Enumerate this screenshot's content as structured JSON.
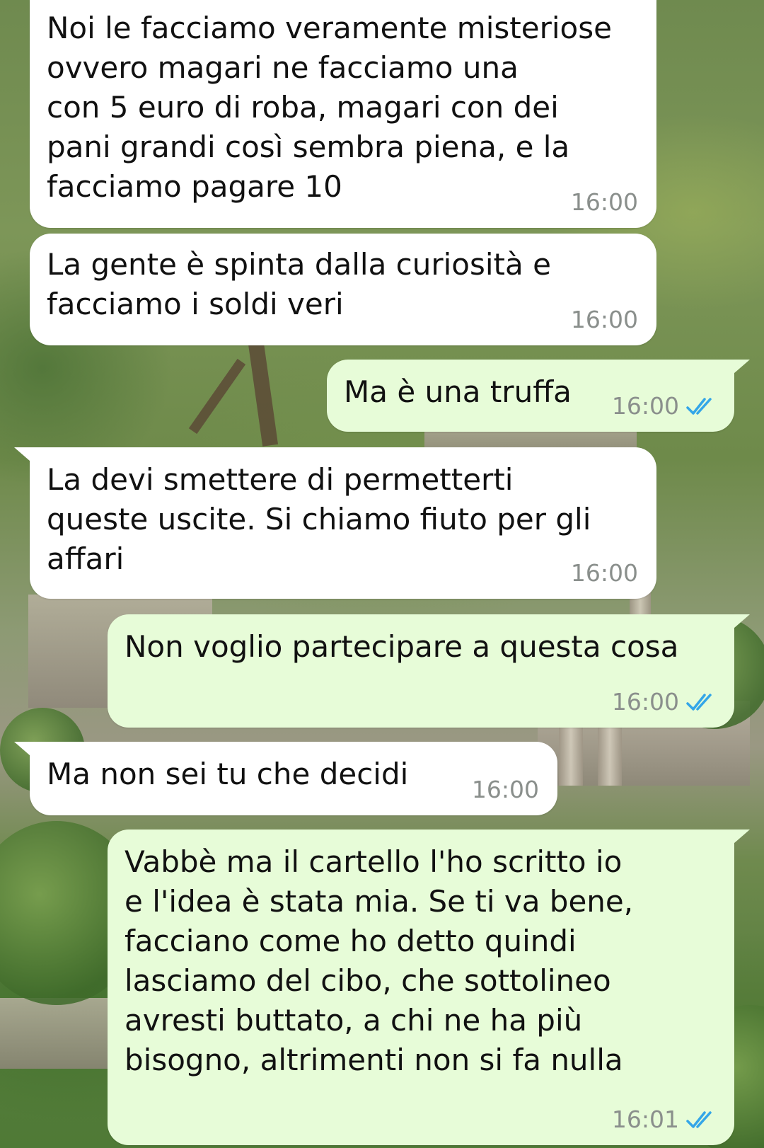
{
  "colors": {
    "incoming_bubble": "#ffffff",
    "outgoing_bubble": "#e7fcd8",
    "timestamp": "#8a8f8c",
    "read_ticks": "#34a6e8"
  },
  "messages": [
    {
      "direction": "incoming",
      "text": "Noi le facciamo veramente misteriose\novvero magari ne facciamo una\ncon 5 euro di roba, magari con dei\npani grandi così sembra piena, e la\nfacciamo pagare 10",
      "time": "16:00"
    },
    {
      "direction": "incoming",
      "text": "La gente è spinta dalla curiosità e\nfacciamo i soldi veri",
      "time": "16:00"
    },
    {
      "direction": "outgoing",
      "text": "Ma è una truffa",
      "time": "16:00",
      "status_icon": "double-check-read-icon"
    },
    {
      "direction": "incoming",
      "text": "La devi smettere di permetterti\nqueste uscite. Si chiamo fiuto per gli\naffari",
      "time": "16:00"
    },
    {
      "direction": "outgoing",
      "text": "Non voglio partecipare a questa cosa",
      "time": "16:00",
      "status_icon": "double-check-read-icon"
    },
    {
      "direction": "incoming",
      "text": "Ma non sei tu che decidi",
      "time": "16:00"
    },
    {
      "direction": "outgoing",
      "text": "Vabbè ma il cartello l'ho scritto io\ne l'idea è stata mia. Se ti va bene,\nfacciano come ho detto quindi\nlasciamo del cibo, che sottolineo\navresti buttato, a chi ne ha più\nbisogno, altrimenti non si fa nulla",
      "time": "16:01",
      "status_icon": "double-check-read-icon"
    }
  ]
}
